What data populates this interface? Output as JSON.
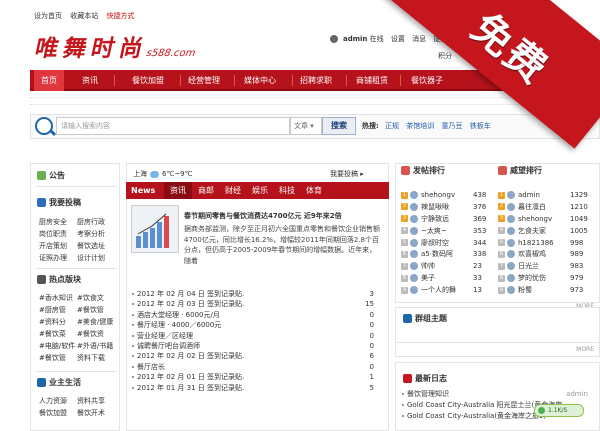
{
  "top_links": {
    "set_home": "设为首页",
    "bookmark": "收藏本站",
    "quick": "快捷方式"
  },
  "logo": {
    "text": "唯舞时尚",
    "domain": "s588.com"
  },
  "user": {
    "name": "admin",
    "status": "在线",
    "links": [
      "设置",
      "消息",
      "提醒"
    ],
    "points_label": "积分"
  },
  "nav": [
    "首页",
    "资讯",
    "餐饮加盟",
    "经营管理",
    "媒体中心",
    "招聘求职",
    "商铺租赁",
    "餐饮器子"
  ],
  "search": {
    "placeholder": "请输入搜索内容",
    "type": "文章",
    "button": "搜索",
    "hot_label": "热搜:",
    "hot": [
      "正规",
      "茶馆培训",
      "童乃豆",
      "铁板车"
    ]
  },
  "left": {
    "announce": "公告",
    "contribute": "我要投稿",
    "links1": [
      "厨房安全",
      "厨房行政",
      "岗位职责",
      "考察分析",
      "开店策划",
      "餐饮选址",
      "证照办理",
      "设计计划"
    ],
    "hot_section": "热点版块",
    "links2": [
      "#香水知识",
      "#饮食文",
      "#厨房管",
      "#餐饮管",
      "#资料分",
      "#美食/健康",
      "#餐饮菜",
      "#餐饮资",
      "#电脑/软件",
      "#外语/书籍",
      "#餐饮管",
      "资料下载"
    ],
    "life": "业主生活",
    "links3": [
      "人力资源",
      "资料共享",
      "餐饮加盟",
      "餐饮开术"
    ]
  },
  "middle": {
    "city": "上海",
    "temp": "6℃~9℃",
    "contribute": "我要投稿",
    "tabs": [
      "News",
      "资讯",
      "商郎",
      "财经",
      "娱乐",
      "科技",
      "体育"
    ],
    "headline": "春节期间零售与餐饮消费达4700亿元 近9年来2倍",
    "desc": "据商务部监测，除夕至正月初六全国重点零售和餐饮企业销售额4700亿元，同比增长16.2%，增幅较2011年同期回落2.8个百分点，但仍高于2005-2009年春节期间的增幅数据。近年来，随着",
    "list": [
      {
        "text": "2012 年 02 月 04 日 签到记录贴.",
        "count": "3"
      },
      {
        "text": "2012 年 02 月 03 日 签到记录贴.",
        "count": "15"
      },
      {
        "text": "酒店大堂经理 · 6000元/月",
        "count": "0"
      },
      {
        "text": "餐厅经理 · 4000／6000元",
        "count": "0"
      },
      {
        "text": "营业经理／区经理",
        "count": "0"
      },
      {
        "text": "诚聘餐厅吧台调酒师",
        "count": "0"
      },
      {
        "text": "2012 年 02 月 02 日 签到记录贴.",
        "count": "6"
      },
      {
        "text": "餐厅店长",
        "count": "0"
      },
      {
        "text": "2012 年 02 月 01 日 签到记录贴.",
        "count": "1"
      },
      {
        "text": "2012 年 01 月 31 日 签到记录贴.",
        "count": "5"
      }
    ]
  },
  "rank": {
    "post_title": "发帖排行",
    "prestige_title": "威望排行",
    "post": [
      {
        "name": "shehongv",
        "num": "438"
      },
      {
        "name": "辣鼠啾啾",
        "num": "376"
      },
      {
        "name": "宁静致远",
        "num": "369"
      },
      {
        "name": "~太爽~",
        "num": "353"
      },
      {
        "name": "廖叔时空",
        "num": "344"
      },
      {
        "name": "a5·数码阿",
        "num": "338"
      },
      {
        "name": "帅帅",
        "num": "23"
      },
      {
        "name": "美子",
        "num": "33"
      },
      {
        "name": "一个人的舞",
        "num": "13"
      }
    ],
    "prestige": [
      {
        "name": "admin",
        "num": "1329"
      },
      {
        "name": "暮往凛白",
        "num": "1210"
      },
      {
        "name": "shehongv",
        "num": "1049"
      },
      {
        "name": "乞食夫家",
        "num": "1005"
      },
      {
        "name": "h1821386",
        "num": "998"
      },
      {
        "name": "欢喜椒鸡",
        "num": "989"
      },
      {
        "name": "日光兰",
        "num": "983"
      },
      {
        "name": "梦的忧伤",
        "num": "979"
      },
      {
        "name": "粉蜀",
        "num": "973"
      }
    ],
    "more": "MORE"
  },
  "group": {
    "title": "群组主题",
    "more": "MORE"
  },
  "logs": {
    "title": "最新日志",
    "items": [
      {
        "text": "餐饮管理知识",
        "who": "admin"
      },
      {
        "text": "Gold Coast City-Australia 阳光昆士兰(黄金海岸",
        "who": ""
      },
      {
        "text": "Gold Coast City-Australia(黄金海岸之旅5)",
        "who": ""
      }
    ],
    "more": "MORE"
  },
  "netspeed": "1.1K/S",
  "ribbon": "免费",
  "colors": {
    "brand_red": "#b5121b",
    "link_blue": "#1e5aa8"
  }
}
